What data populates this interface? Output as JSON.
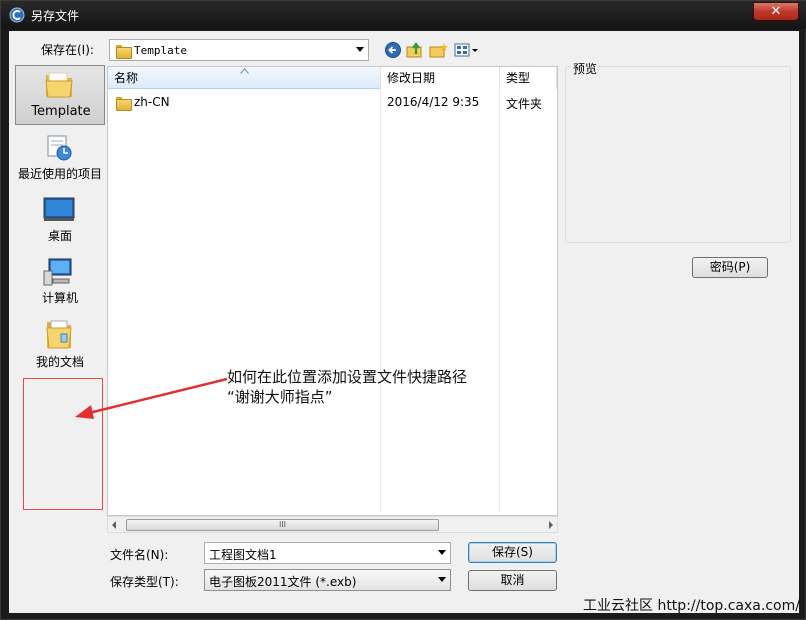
{
  "window": {
    "title": "另存文件",
    "close_glyph": "✕"
  },
  "location": {
    "label": "保存在(I):",
    "value": "Template"
  },
  "places": [
    {
      "id": "template",
      "label": "Template",
      "icon": "folder-icon",
      "selected": true
    },
    {
      "id": "recent",
      "label": "最近使用的项目",
      "icon": "recent-items-icon"
    },
    {
      "id": "desktop",
      "label": "桌面",
      "icon": "desktop-icon"
    },
    {
      "id": "computer",
      "label": "计算机",
      "icon": "computer-icon"
    },
    {
      "id": "documents",
      "label": "我的文档",
      "icon": "documents-icon"
    }
  ],
  "filelist": {
    "columns": [
      "名称",
      "修改日期",
      "类型"
    ],
    "rows": [
      {
        "name": "zh-CN",
        "date": "2016/4/12 9:35",
        "type": "文件夹"
      }
    ],
    "scroll_grip": "III"
  },
  "preview": {
    "title": "预览"
  },
  "password_button": "密码(P)",
  "filename": {
    "label": "文件名(N):",
    "value": "工程图文档1"
  },
  "filetype": {
    "label": "保存类型(T):",
    "value": "电子图板2011文件 (*.exb)"
  },
  "save_button": "保存(S)",
  "cancel_button": "取消",
  "annotation": {
    "line1": "如何在此位置添加设置文件快捷路径",
    "line2": "“谢谢大师指点”"
  },
  "watermark": "工业云社区 http://top.caxa.com/",
  "colors": {
    "highlight_red": "#e84a4a",
    "arrow_red": "#e03030",
    "folder_yellow": "#f6d66c"
  }
}
